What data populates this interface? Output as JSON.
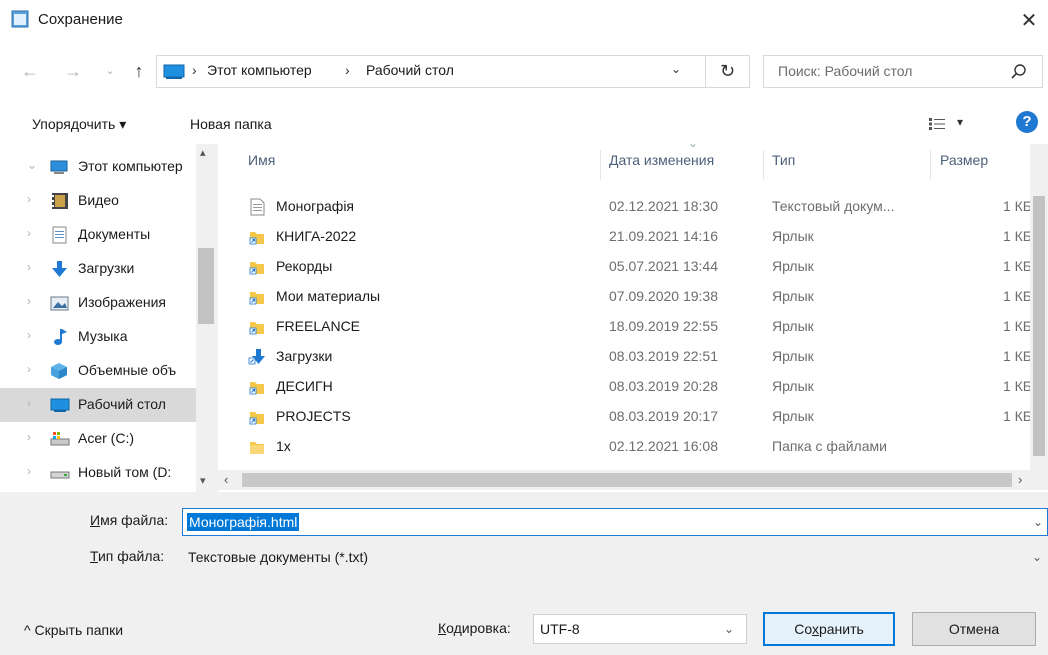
{
  "window": {
    "title": "Сохранение",
    "close_glyph": "✕"
  },
  "nav": {
    "back_glyph": "←",
    "forward_glyph": "→",
    "recent_glyph": "⌄",
    "up_glyph": "↑"
  },
  "address": {
    "sep": "›",
    "crumbs": [
      "Этот компьютер",
      "Рабочий стол"
    ],
    "dropdown_glyph": "⌄",
    "refresh_glyph": "↻"
  },
  "search": {
    "placeholder": "Поиск: Рабочий стол",
    "icon": "search-icon"
  },
  "toolbar": {
    "organize_label": "Упорядочить ▾",
    "new_folder_label": "Новая папка",
    "view_dropdown_glyph": "▾",
    "help_label": "?"
  },
  "navpane": {
    "items": [
      {
        "label": "Этот компьютер",
        "icon": "computer-icon",
        "chevron": "⌄"
      },
      {
        "label": "Видео",
        "icon": "video-icon",
        "chevron": "›"
      },
      {
        "label": "Документы",
        "icon": "documents-icon",
        "chevron": "›"
      },
      {
        "label": "Загрузки",
        "icon": "downloads-icon",
        "chevron": "›"
      },
      {
        "label": "Изображения",
        "icon": "images-icon",
        "chevron": "›"
      },
      {
        "label": "Музыка",
        "icon": "music-icon",
        "chevron": "›"
      },
      {
        "label": "Объемные объ",
        "icon": "3d-objects-icon",
        "chevron": "›"
      },
      {
        "label": "Рабочий стол",
        "icon": "desktop-icon",
        "chevron": "›",
        "selected": true
      },
      {
        "label": "Acer (C:)",
        "icon": "drive-c-icon",
        "chevron": "›"
      },
      {
        "label": "Новый том (D:",
        "icon": "drive-d-icon",
        "chevron": "›"
      }
    ],
    "scroll_up_glyph": "▴",
    "scroll_down_glyph": "▾"
  },
  "filelist": {
    "columns": {
      "name": "Имя",
      "date": "Дата изменения",
      "type": "Тип",
      "size": "Размер"
    },
    "sort_glyph": "⌄",
    "rows": [
      {
        "name": "Монографія",
        "date": "02.12.2021 18:30",
        "type": "Текстовый докум...",
        "size": "1 КБ",
        "icon": "text-document-icon"
      },
      {
        "name": "КНИГА-2022",
        "date": "21.09.2021 14:16",
        "type": "Ярлык",
        "size": "1 КБ",
        "icon": "folder-shortcut-icon"
      },
      {
        "name": "Рекорды",
        "date": "05.07.2021 13:44",
        "type": "Ярлык",
        "size": "1 КБ",
        "icon": "folder-shortcut-icon"
      },
      {
        "name": "Мои материалы",
        "date": "07.09.2020 19:38",
        "type": "Ярлык",
        "size": "1 КБ",
        "icon": "folder-shortcut-icon"
      },
      {
        "name": "FREELANCE",
        "date": "18.09.2019 22:55",
        "type": "Ярлык",
        "size": "1 КБ",
        "icon": "folder-shortcut-icon"
      },
      {
        "name": "Загрузки",
        "date": "08.03.2019 22:51",
        "type": "Ярлык",
        "size": "1 КБ",
        "icon": "downloads-shortcut-icon"
      },
      {
        "name": "ДЕСИГН",
        "date": "08.03.2019 20:28",
        "type": "Ярлык",
        "size": "1 КБ",
        "icon": "folder-shortcut-icon"
      },
      {
        "name": "PROJECTS",
        "date": "08.03.2019 20:17",
        "type": "Ярлык",
        "size": "1 КБ",
        "icon": "folder-shortcut-icon"
      },
      {
        "name": "1x",
        "date": "02.12.2021 16:08",
        "type": "Папка с файлами",
        "size": "",
        "icon": "folder-icon"
      }
    ],
    "hscroll_left_glyph": "‹",
    "hscroll_right_glyph": "›"
  },
  "form": {
    "filename_label_accel": "И",
    "filename_label_rest": "мя файла:",
    "filename_value": "Монографія.html",
    "filetype_label_accel": "Т",
    "filetype_label_rest": "ип файла:",
    "filetype_value": "Текстовые документы (*.txt)",
    "chevron": "⌄"
  },
  "footer": {
    "hide_folders_label": "^  Скрыть папки",
    "encoding_label_accel": "К",
    "encoding_label_rest": "одировка:",
    "encoding_value": "UTF-8",
    "save_label_pre": "Со",
    "save_label_accel": "х",
    "save_label_post": "ранить",
    "cancel_label": "Отмена"
  },
  "colors": {
    "accent": "#0078d7",
    "selection": "#d9d9d9",
    "folder": "#f5c84c",
    "header_text": "#4c607a"
  }
}
